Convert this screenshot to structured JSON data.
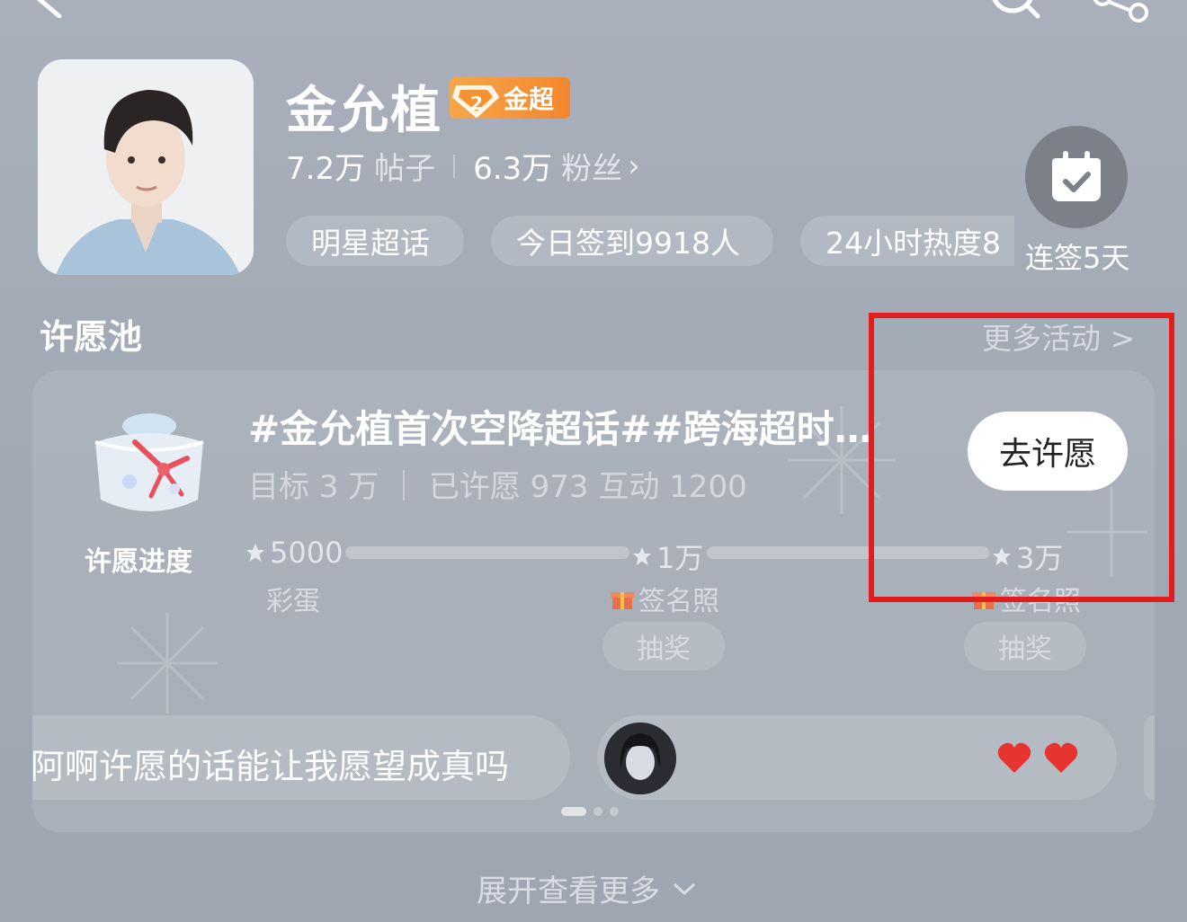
{
  "header": {
    "back_icon": "back-arrow-icon",
    "search_icon": "search-icon",
    "share_icon": "share-icon"
  },
  "profile": {
    "name": "金允植",
    "level_badge": "金超",
    "level_number": "2",
    "posts_count": "7.2万",
    "posts_label": "帖子",
    "fans_count": "6.3万",
    "fans_label": "粉丝",
    "chips": [
      "明星超话",
      "今日签到9918人",
      "24小时热度8"
    ],
    "checkin_label": "连签5天"
  },
  "wish_pool": {
    "section_title": "许愿池",
    "more_activities": "更多活动 >",
    "progress_label": "许愿进度",
    "topic_title": "#金允植首次空降超话##跨海超时…",
    "topic_stats": "目标 3 万 ｜ 已许愿 973 互动 1200",
    "wish_button": "去许愿",
    "milestones": [
      {
        "value": "5000",
        "reward": "彩蛋",
        "action": ""
      },
      {
        "value": "1万",
        "reward": "签名照",
        "action": "抽奖"
      },
      {
        "value": "3万",
        "reward": "签名照",
        "action": "抽奖"
      }
    ],
    "bubbles": [
      {
        "text": "阿啊许愿的话能让我愿望成真吗"
      }
    ]
  },
  "expand_more": "展开查看更多",
  "colors": {
    "background": "#a4acb7",
    "badge_orange": "#f3862c",
    "highlight_red": "#e31d1d",
    "heart_red": "#e8342e"
  }
}
